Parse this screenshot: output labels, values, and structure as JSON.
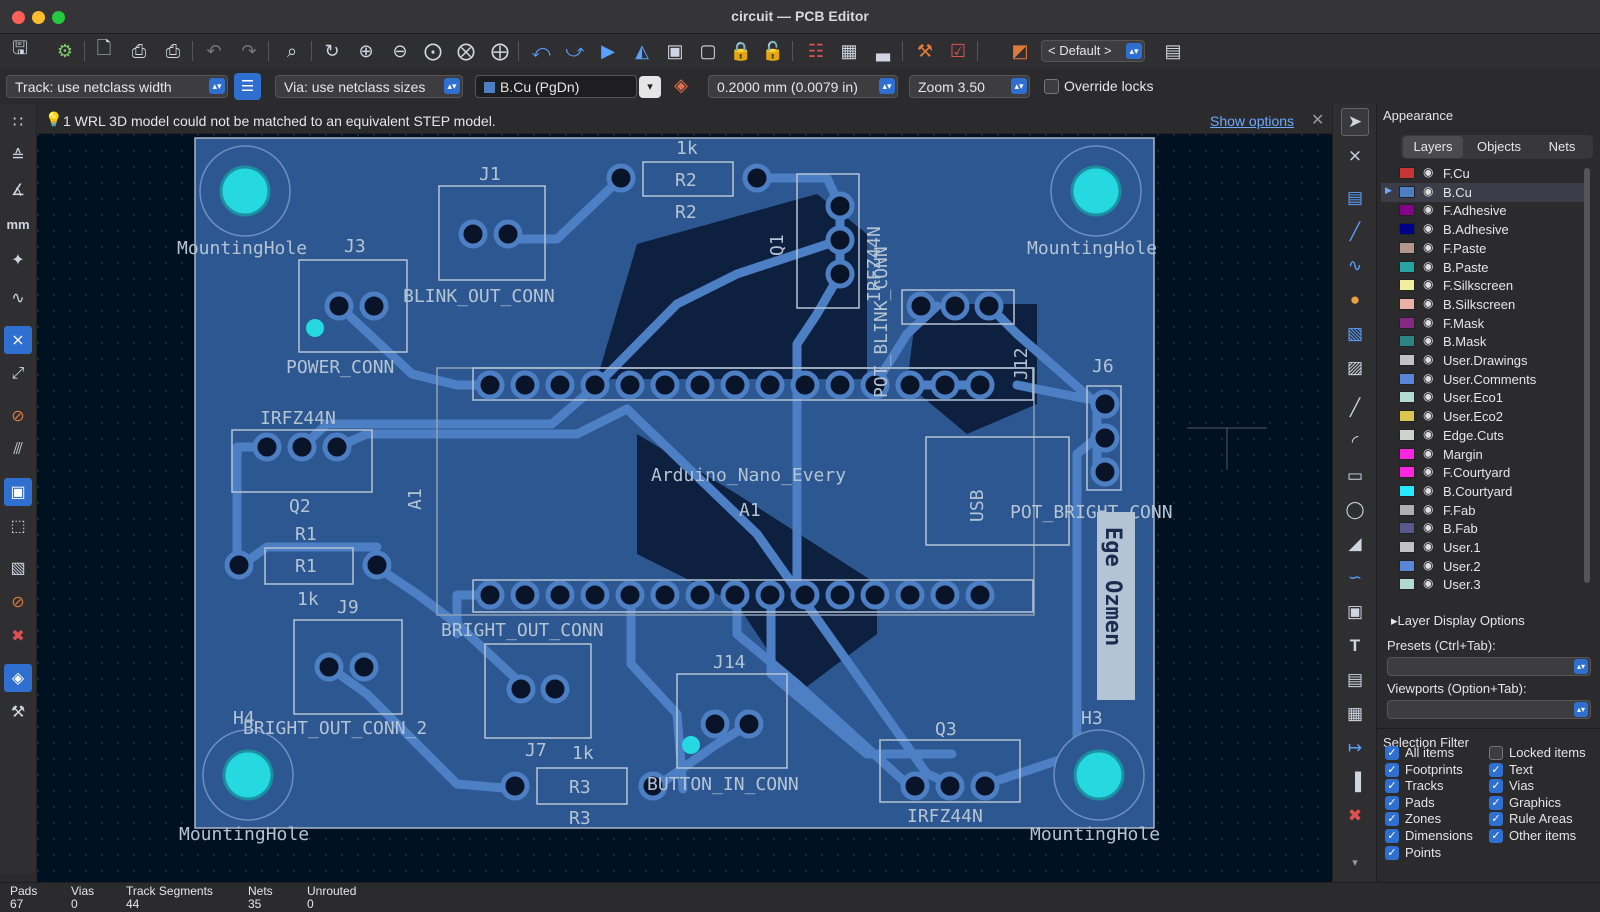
{
  "window": {
    "title": "circuit — PCB Editor"
  },
  "toolbar": {
    "icons": [
      "save-icon",
      "board-setup-icon",
      "page-settings-icon",
      "print-icon",
      "plot-icon",
      "undo-icon",
      "redo-icon",
      "find-icon",
      "refresh-icon",
      "zoom-in-icon",
      "zoom-out-icon",
      "zoom-fit-icon",
      "zoom-objects-icon",
      "zoom-selection-icon",
      "rotate-ccw-icon",
      "rotate-cw-icon",
      "flip-icon",
      "mirror-icon",
      "group-icon",
      "ungroup-icon",
      "lock-icon",
      "unlock-icon",
      "update-pcb-icon",
      "footprint-editor-icon",
      "footprint-browser-icon",
      "scripting-icon",
      "drc-icon",
      "layer-pair-icon",
      "console-icon"
    ],
    "layer_preset": "< Default >"
  },
  "options": {
    "track": "Track: use netclass width",
    "via": "Via: use netclass sizes",
    "layer": "B.Cu (PgDn)",
    "grid": "0.2000 mm (0.0079 in)",
    "zoom": "Zoom 3.50",
    "override_locks": "Override locks"
  },
  "infobar": {
    "message": "1 WRL 3D model could not be matched to an equivalent STEP model.",
    "action": "Show options"
  },
  "board": {
    "labels": {
      "mh_tl": "MountingHole",
      "mh_tr": "MountingHole",
      "mh_bl": "MountingHole",
      "mh_br": "MountingHole",
      "j1": "J1",
      "j1_conn": "BLINK_OUT_CONN",
      "j3": "J3",
      "j3_conn": "POWER_CONN",
      "r2_val": "1k",
      "r2": "R2",
      "r2_ref": "R2",
      "q1": "Q1",
      "q1_val": "IRFZ44N",
      "j12": "J12",
      "blink_conn": "POT_BLINK_CONN",
      "j6": "J6",
      "pot_bright": "POT_BRIGHT_CONN",
      "usb": "USB",
      "arduino": "Arduino_Nano_Every",
      "a1": "A1",
      "a1_side": "A1",
      "q2_val": "IRFZ44N",
      "q2": "Q2",
      "r1": "R1",
      "r1_ref": "R1",
      "r1_val": "1k",
      "j9": "J9",
      "bright_out": "BRIGHT_OUT_CONN",
      "bright_out2": "BRIGHT_OUT_CONN_2",
      "h4": "H4",
      "j7": "J7",
      "r3_val": "1k",
      "r3": "R3",
      "r3_ref": "R3",
      "j14": "J14",
      "button_in": "BUTTON_IN_CONN",
      "q3": "Q3",
      "q3_val": "IRFZ44N",
      "h3": "H3",
      "author": "Ege Ozmen"
    }
  },
  "appearance": {
    "title": "Appearance",
    "tabs": [
      "Layers",
      "Objects",
      "Nets"
    ],
    "layers": [
      {
        "name": "F.Cu",
        "color": "#c83434"
      },
      {
        "name": "B.Cu",
        "color": "#4d7fc4"
      },
      {
        "name": "F.Adhesive",
        "color": "#84008b"
      },
      {
        "name": "B.Adhesive",
        "color": "#00008b"
      },
      {
        "name": "F.Paste",
        "color": "#b5968c"
      },
      {
        "name": "B.Paste",
        "color": "#26a3a3"
      },
      {
        "name": "F.Silkscreen",
        "color": "#f2eda1"
      },
      {
        "name": "B.Silkscreen",
        "color": "#e8b2a7"
      },
      {
        "name": "F.Mask",
        "color": "#842a84"
      },
      {
        "name": "B.Mask",
        "color": "#2a8484"
      },
      {
        "name": "User.Drawings",
        "color": "#c2c2c2"
      },
      {
        "name": "User.Comments",
        "color": "#5986d6"
      },
      {
        "name": "User.Eco1",
        "color": "#b4dbd2"
      },
      {
        "name": "User.Eco2",
        "color": "#d8c852"
      },
      {
        "name": "Edge.Cuts",
        "color": "#d0d2cd"
      },
      {
        "name": "Margin",
        "color": "#ff26e2"
      },
      {
        "name": "F.Courtyard",
        "color": "#ff26e2"
      },
      {
        "name": "B.Courtyard",
        "color": "#26e9ff"
      },
      {
        "name": "F.Fab",
        "color": "#afafaf"
      },
      {
        "name": "B.Fab",
        "color": "#58588c"
      },
      {
        "name": "User.1",
        "color": "#c2c2c2"
      },
      {
        "name": "User.2",
        "color": "#5986d6"
      },
      {
        "name": "User.3",
        "color": "#b4dbd2"
      }
    ],
    "layer_display_options": "Layer Display Options",
    "presets_label": "Presets (Ctrl+Tab):",
    "viewports_label": "Viewports (Option+Tab):"
  },
  "selection_filter": {
    "title": "Selection Filter",
    "items": [
      {
        "label": "All items",
        "checked": true
      },
      {
        "label": "Locked items",
        "checked": false
      },
      {
        "label": "Footprints",
        "checked": true
      },
      {
        "label": "Text",
        "checked": true
      },
      {
        "label": "Tracks",
        "checked": true
      },
      {
        "label": "Vias",
        "checked": true
      },
      {
        "label": "Pads",
        "checked": true
      },
      {
        "label": "Graphics",
        "checked": true
      },
      {
        "label": "Zones",
        "checked": true
      },
      {
        "label": "Rule Areas",
        "checked": true
      },
      {
        "label": "Dimensions",
        "checked": true
      },
      {
        "label": "Other items",
        "checked": true
      },
      {
        "label": "Points",
        "checked": true
      }
    ]
  },
  "status": {
    "pads_label": "Pads",
    "pads": "67",
    "vias_label": "Vias",
    "vias": "0",
    "tracks_label": "Track Segments",
    "tracks": "44",
    "nets_label": "Nets",
    "nets": "35",
    "unrouted_label": "Unrouted",
    "unrouted": "0"
  },
  "colors": {
    "canvas": "#001122",
    "board_fill": "#2c5790",
    "track": "#4d7fc4",
    "mounting_hole": "#26d8e0",
    "accent": "#2f6fd0"
  }
}
